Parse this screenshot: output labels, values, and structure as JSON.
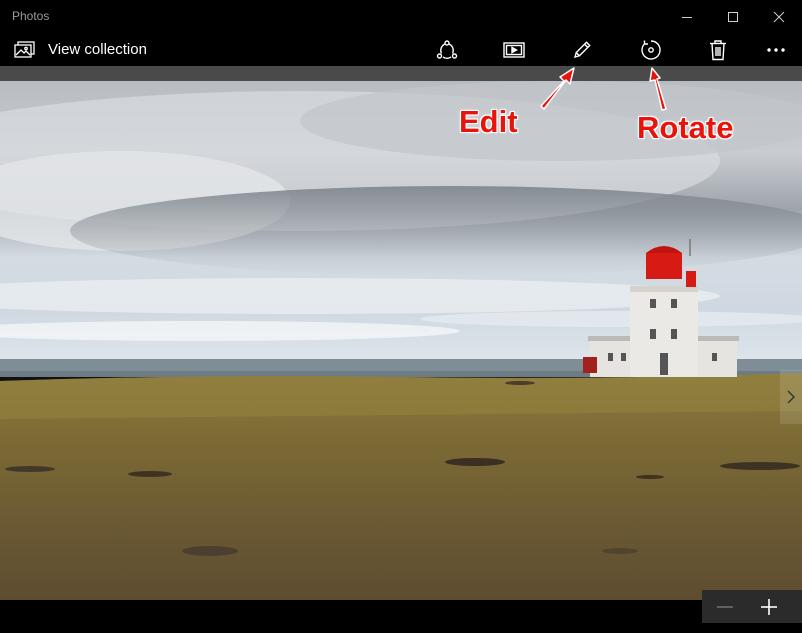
{
  "window": {
    "title": "Photos",
    "controls": [
      "minimize",
      "maximize",
      "close"
    ]
  },
  "commandbar": {
    "view_collection_label": "View collection",
    "buttons": [
      {
        "name": "share",
        "icon": "share-icon"
      },
      {
        "name": "slideshow",
        "icon": "slideshow-icon"
      },
      {
        "name": "edit",
        "icon": "pencil-icon"
      },
      {
        "name": "rotate",
        "icon": "rotate-icon"
      },
      {
        "name": "delete",
        "icon": "trash-icon"
      },
      {
        "name": "more",
        "icon": "more-icon"
      }
    ]
  },
  "annotations": {
    "edit_label": "Edit",
    "rotate_label": "Rotate",
    "color": "#e8140c"
  },
  "zoom": {
    "out_icon": "minus-icon",
    "in_icon": "plus-icon"
  },
  "photo": {
    "subject": "lighthouse-photo"
  }
}
